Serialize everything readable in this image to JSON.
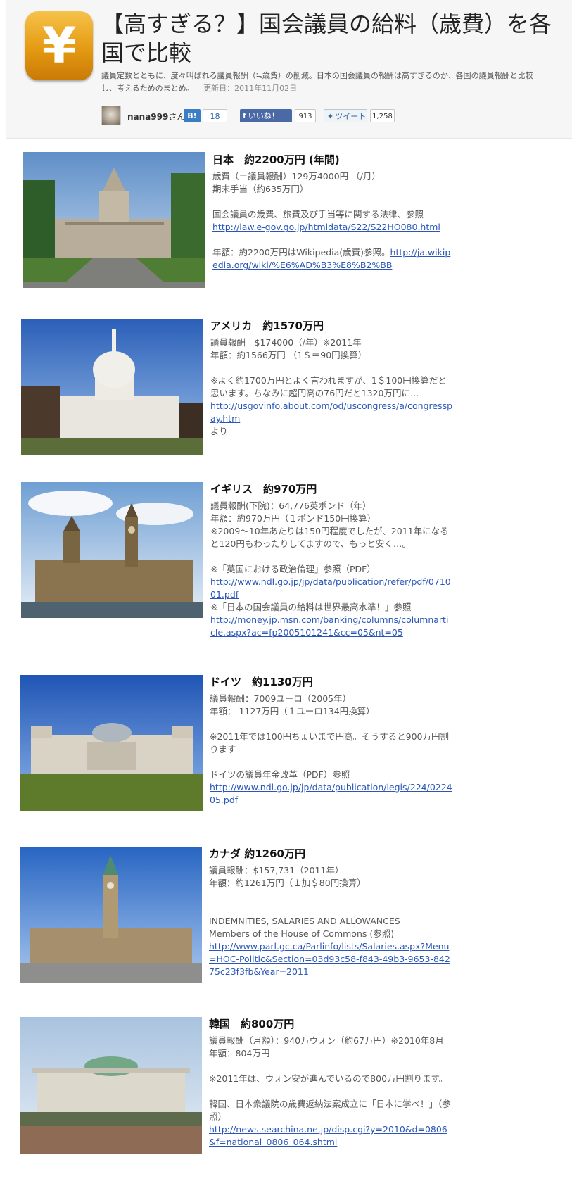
{
  "header": {
    "logo_char": "¥",
    "title": "【高すぎる？】国会議員の給料（歳費）を各国で比較",
    "description": "議員定数とともに、度々叫ばれる議員報酬（≒歳費）の削減。日本の国会議員の報酬は高すぎるのか、各国の議員報酬と比較し、考えるためのまとめ。",
    "updated": "更新日：2011年11月02日",
    "author": "nana999",
    "author_suffix": "さん",
    "hatena_label": "B!",
    "hatena_count": "18",
    "facebook_label": "いいね！",
    "facebook_count": "913",
    "tweet_label": "ツイート",
    "tweet_count": "1,258"
  },
  "items": [
    {
      "title": "日本　約2200万円 (年間)",
      "lines": [
        "歳費（＝議員報酬）129万4000円 （/月）",
        "期末手当（約635万円）"
      ],
      "ref": "国会議員の歳費、旅費及び手当等に関する法律、参照",
      "link1": "http://law.e-gov.go.jp/htmldata/S22/S22HO080.html",
      "note": "年額：約2200万円はWikipedia(歳費)参照。",
      "link2": "http://ja.wikipedia.org/wiki/%E6%AD%B3%E8%B2%BB"
    },
    {
      "title": "アメリカ　約1570万円",
      "lines": [
        "議員報酬　$174000（/年）※2011年",
        "年額：約1566万円 （1＄＝90円換算）"
      ],
      "note": "※よく約1700万円とよく言われますが、1＄100円換算だと思います。ちなみに超円高の76円だと1320万円に…",
      "link1": "http://usgovinfo.about.com/od/uscongress/a/congresspay.htm",
      "suffix": "より"
    },
    {
      "title": "イギリス　約970万円",
      "lines": [
        "議員報酬(下院)：64,776英ポンド（年）",
        "年額：約970万円（１ポンド150円換算）",
        "※2009〜10年あたりは150円程度でしたが、2011年になると120円もわったりしてますので、もっと安く…。"
      ],
      "ref1": "※「英国における政治倫理」参照（PDF）",
      "link1": "http://www.ndl.go.jp/jp/data/publication/refer/pdf/071001.pdf",
      "ref2": "※「日本の国会議員の給料は世界最高水準！」参照",
      "link2": "http://money.jp.msn.com/banking/columns/columnarticle.aspx?ac=fp2005101241&cc=05&nt=05"
    },
    {
      "title": "ドイツ　約1130万円",
      "lines": [
        "議員報酬：7009ユーロ（2005年）",
        "年額： 1127万円（１ユーロ134円換算）"
      ],
      "note": "※2011年では100円ちょいまで円高。そうすると900万円割ります",
      "ref": "ドイツの議員年金改革（PDF）参照",
      "link1": "http://www.ndl.go.jp/jp/data/publication/legis/224/022405.pdf"
    },
    {
      "title": "カナダ 約1260万円",
      "lines": [
        "議員報酬：$157,731（2011年）",
        "年額：約1261万円（１加＄80円換算）"
      ],
      "ref1": "INDEMNITIES, SALARIES AND ALLOWANCES",
      "ref2": "Members of the House of Commons (参照)",
      "link1": "http://www.parl.gc.ca/Parlinfo/lists/Salaries.aspx?Menu=HOC-Politic&Section=03d93c58-f843-49b3-9653-84275c23f3fb&Year=2011"
    },
    {
      "title": "韓国　約800万円",
      "lines": [
        "議員報酬（月額）：940万ウォン（約67万円）※2010年8月",
        "年額：804万円"
      ],
      "note": "※2011年は、ウォン安が進んでいるので800万円割ります。",
      "ref": "韓国、日本衆議院の歳費返納法案成立に「日本に学べ！」（参照）",
      "link1": "http://news.searchina.ne.jp/disp.cgi?y=2010&d=0806&f=national_0806_064.shtml"
    }
  ],
  "colors": {
    "link": "#2a56b8",
    "logo": "#e49a12",
    "hatena": "#3c7ec6",
    "facebook": "#4b6aa5"
  }
}
